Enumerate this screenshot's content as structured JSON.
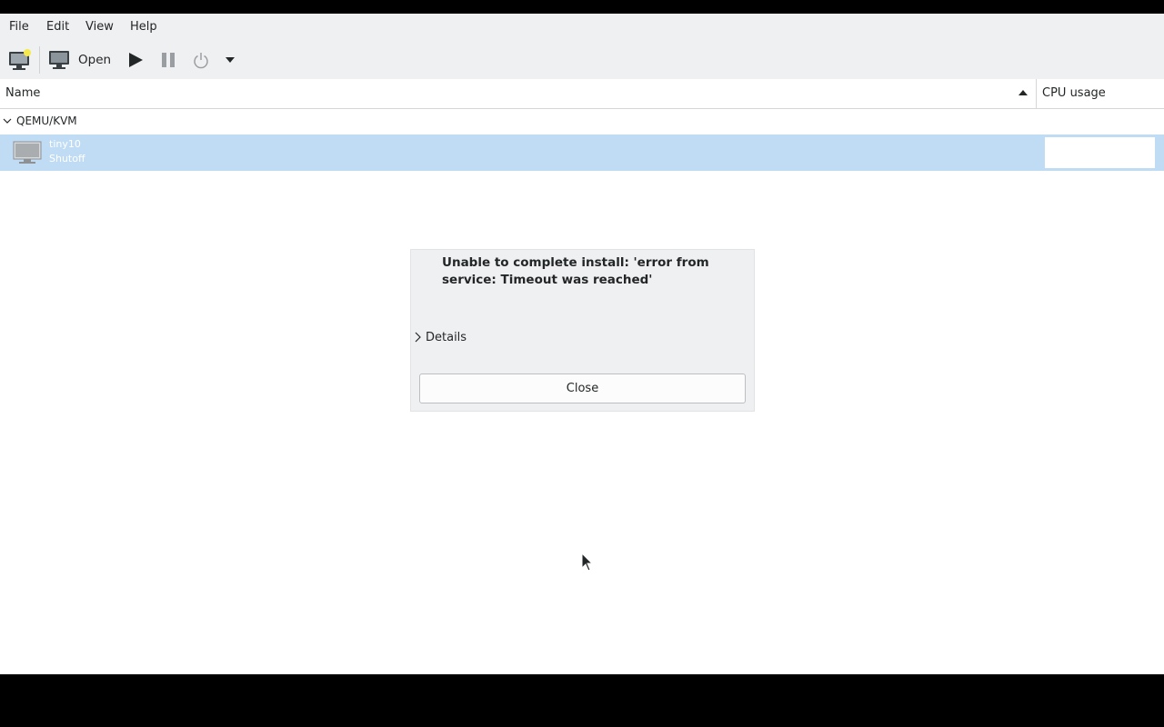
{
  "menubar": {
    "items": [
      "File",
      "Edit",
      "View",
      "Help"
    ]
  },
  "toolbar": {
    "new_vm_icon": "monitor-new-icon",
    "open_icon": "monitor-icon",
    "open_label": "Open",
    "run_icon": "play-icon",
    "pause_icon": "pause-icon",
    "shutdown_icon": "power-icon",
    "menu_icon": "dropdown-arrow-icon"
  },
  "columns": {
    "name": "Name",
    "cpu": "CPU usage"
  },
  "connection": {
    "label": "QEMU/KVM"
  },
  "vm": {
    "name": "tiny10",
    "status": "Shutoff"
  },
  "dialog": {
    "message": "Unable to complete install: 'error from service: Timeout was reached'",
    "details_label": "Details",
    "close_label": "Close"
  },
  "colors": {
    "selection": "#bfdcf4",
    "toolbar_bg": "#eff0f1",
    "dialog_bg": "#eff0f1"
  }
}
